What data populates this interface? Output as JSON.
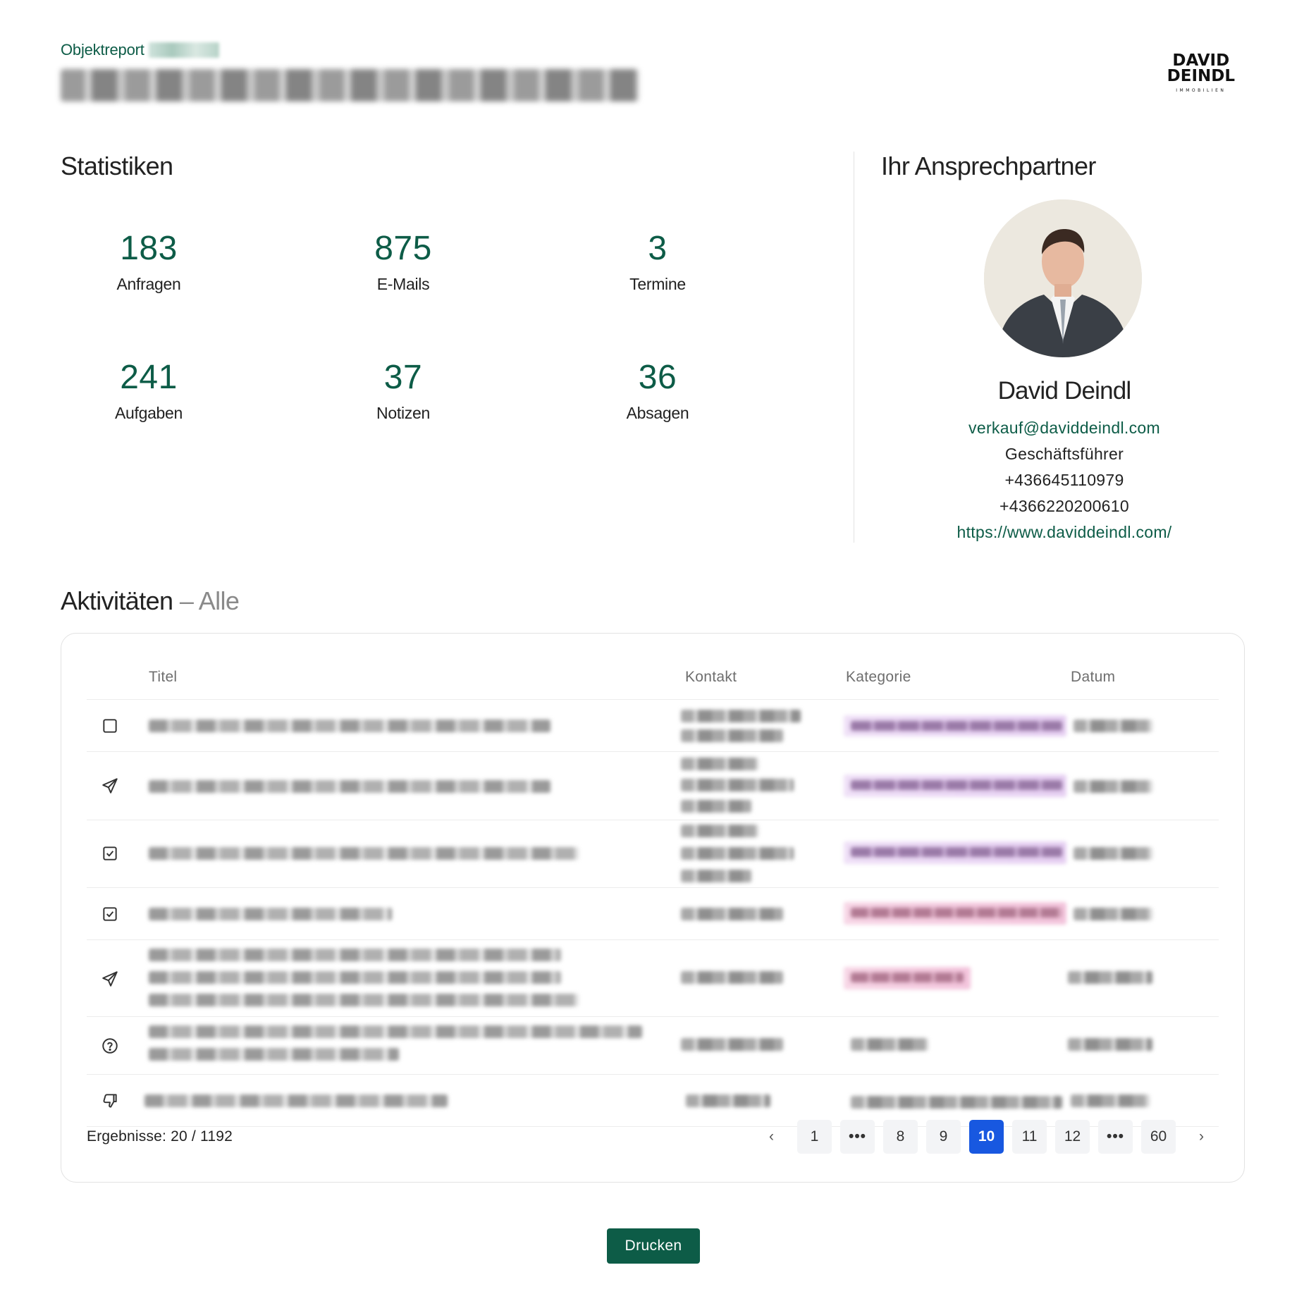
{
  "header": {
    "eyebrow": "Objektreport",
    "logo_line1": "DAVID",
    "logo_line2": "DEINDL",
    "logo_line3": "IMMOBILIEN"
  },
  "stats": {
    "title": "Statistiken",
    "items": [
      {
        "value": "183",
        "label": "Anfragen"
      },
      {
        "value": "875",
        "label": "E-Mails"
      },
      {
        "value": "3",
        "label": "Termine"
      },
      {
        "value": "241",
        "label": "Aufgaben"
      },
      {
        "value": "37",
        "label": "Notizen"
      },
      {
        "value": "36",
        "label": "Absagen"
      }
    ]
  },
  "contact": {
    "title": "Ihr Ansprechpartner",
    "name": "David Deindl",
    "email": "verkauf@daviddeindl.com",
    "role": "Geschäftsführer",
    "phone1": "+436645110979",
    "phone2": "+4366220200610",
    "website": "https://www.daviddeindl.com/"
  },
  "activities": {
    "title": "Aktivitäten",
    "filter": "– Alle",
    "columns": {
      "title": "Titel",
      "contact": "Kontakt",
      "category": "Kategorie",
      "date": "Datum"
    },
    "row_icons": [
      "square-icon",
      "send-icon",
      "check-square-icon",
      "check-square-icon",
      "send-icon",
      "help-circle-icon",
      "thumbs-down-icon"
    ],
    "results_label": "Ergebnisse: 20 / 1192",
    "pagination": {
      "prev": "‹",
      "pages": [
        "1",
        "•••",
        "8",
        "9",
        "10",
        "11",
        "12",
        "•••",
        "60"
      ],
      "active": "10",
      "next": "›"
    }
  },
  "print_button": "Drucken",
  "colors": {
    "brand_green": "#0d5c47",
    "pager_active": "#1858e0"
  }
}
